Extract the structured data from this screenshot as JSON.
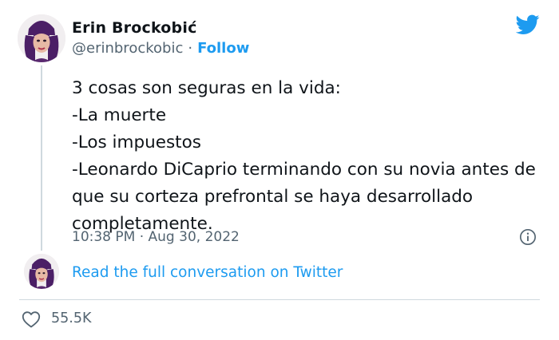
{
  "tweet": {
    "author_name": "Erin Brockobić",
    "handle": "@erinbrockobic",
    "separator": "·",
    "follow_label": "Follow",
    "text": "3 cosas son seguras en la vida:\n-La muerte\n-Los impuestos\n-Leonardo DiCaprio terminando con su novia antes de que su corteza prefrontal se haya desarrollado completamente.",
    "timestamp": "10:38 PM · Aug 30, 2022",
    "read_full_label": "Read the full conversation on Twitter",
    "likes_count": "55.5K"
  },
  "icons": {
    "brand": "twitter-bird-icon",
    "info": "info-icon",
    "like": "heart-icon"
  },
  "colors": {
    "accent": "#1d9bf0",
    "secondary_text": "#536471",
    "primary_text": "#0f1419",
    "divider": "#cfd9de"
  }
}
